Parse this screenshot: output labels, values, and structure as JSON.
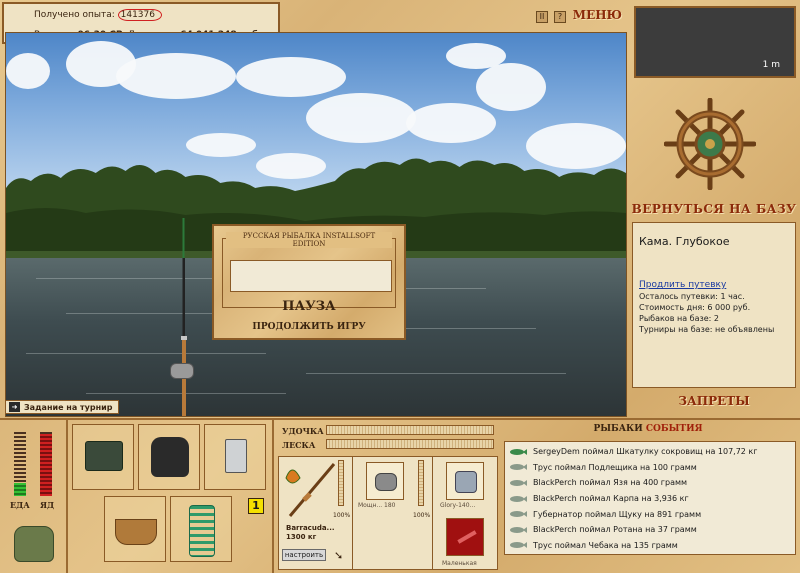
{
  "status": {
    "experience_label": "Получено опыта:",
    "experience_value": "141376",
    "time_label": "Время:",
    "time_value": "06:30 СР",
    "money_label": "Деньги:",
    "money_value": "64 041 248 руб."
  },
  "top": {
    "menu_label": "МЕНЮ",
    "pause_btn": "II",
    "help_btn": "?"
  },
  "minimap": {
    "label": "1 m"
  },
  "scene": {
    "task_label": "Задание на турнир"
  },
  "pause_dialog": {
    "header": "РУССКАЯ РЫБАЛКА INSTALLSOFT EDITION",
    "title": "ПАУЗА",
    "continue": "ПРОДОЛЖИТЬ ИГРУ"
  },
  "right": {
    "back_to_base": "ВЕРНУТЬСЯ НА БАЗУ",
    "location": "Кама. Глубокое",
    "extend_link": "Продлить путевку",
    "lines": [
      "Осталось путевки: 1 час.",
      "Стоимость дня: 6 000 руб.",
      "Рыбаков на базе: 2",
      "Турниры на базе: не объявлены"
    ],
    "bans": "ЗАПРЕТЫ"
  },
  "meters": {
    "food_label": "ЕДА",
    "drink_label": "ЯД",
    "food_level": 0.2,
    "poison_level": 0.97
  },
  "inventory": {
    "badge": "1"
  },
  "tackle": {
    "rod_label": "УДОЧКА",
    "line_label": "ЛЕСКА",
    "rod_name": "Barracuda...",
    "rod_weight": "1300 кг",
    "rod_pct": "100%",
    "setup_button": "настроить",
    "reel_caption": "Мощн... 180",
    "reel_pct": "100%",
    "line_caption": "Glory-140...",
    "bait_caption": "Маленькая"
  },
  "events": {
    "title_a": "РЫБАКИ",
    "title_b": "СОБЫТИЯ",
    "items": [
      "SergeyDem поймал Шкатулку сокровищ на 107,72 кг",
      "Трус поймал Подлещика на 100 грамм",
      "BlackPerch поймал Язя на 400 грамм",
      "BlackPerch поймал Карпа на 3,936 кг",
      "Губернатор поймал Щуку на 891 грамм",
      "BlackPerch поймал Ротана на 37 грамм",
      "Трус поймал Чебака на 135 грамм"
    ]
  },
  "colors": {
    "wood": "#e2c084",
    "accent_red": "#8b2a0a",
    "panel_bg": "#efe3c4"
  }
}
